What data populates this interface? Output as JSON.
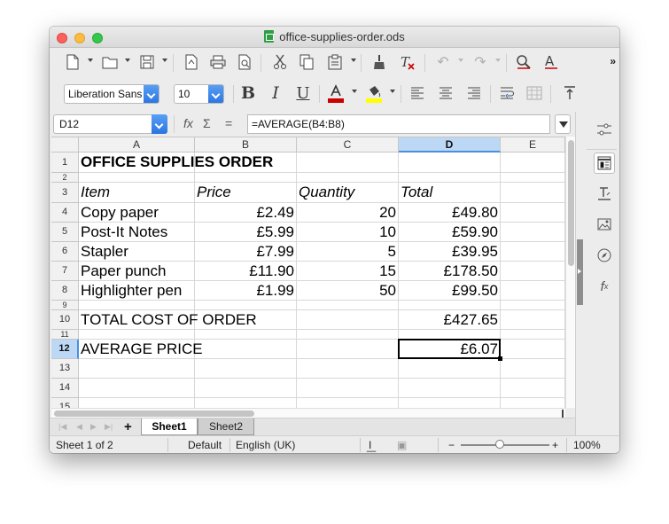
{
  "window": {
    "title": "office-supplies-order.ods"
  },
  "icons": {
    "new": "new-document-icon",
    "open": "open-folder-icon",
    "save": "save-icon",
    "export_pdf": "export-pdf-icon",
    "print": "print-icon",
    "print_preview": "print-preview-icon",
    "cut": "cut-icon",
    "copy": "copy-icon",
    "paste": "paste-icon",
    "clone": "clone-formatting-icon",
    "clear": "clear-formatting-icon",
    "undo": "undo-icon",
    "redo": "redo-icon",
    "find": "find-replace-icon",
    "spelling": "spelling-icon"
  },
  "toolbar2": {
    "font_name": "Liberation Sans",
    "font_size": "10",
    "bold": "B",
    "italic": "I",
    "underline": "U",
    "font_color": "#cc0000",
    "highlight_color": "#ffff00",
    "toolbar_more": "»"
  },
  "formula_bar": {
    "cell_ref": "D12",
    "fx_label": "fx",
    "sum_label": "Σ",
    "equals_label": "=",
    "formula": "=AVERAGE(B4:B8)"
  },
  "columns": [
    "A",
    "B",
    "C",
    "D",
    "E"
  ],
  "selected_column": "D",
  "rows": [
    "1",
    "2",
    "3",
    "4",
    "5",
    "6",
    "7",
    "8",
    "9",
    "10",
    "11",
    "12",
    "13",
    "14",
    "15"
  ],
  "selected_row": "12",
  "cells": {
    "title": "OFFICE SUPPLIES ORDER",
    "header_item": "Item",
    "header_price": "Price",
    "header_quantity": "Quantity",
    "header_total": "Total",
    "items": [
      {
        "item": "Copy paper",
        "price": "£2.49",
        "quantity": "20",
        "total": "£49.80"
      },
      {
        "item": "Post-It Notes",
        "price": "£5.99",
        "quantity": "10",
        "total": "£59.90"
      },
      {
        "item": "Stapler",
        "price": "£7.99",
        "quantity": "5",
        "total": "£39.95"
      },
      {
        "item": "Paper punch",
        "price": "£11.90",
        "quantity": "15",
        "total": "£178.50"
      },
      {
        "item": "Highlighter pen",
        "price": "£1.99",
        "quantity": "50",
        "total": "£99.50"
      }
    ],
    "total_label": "TOTAL COST OF ORDER",
    "total_value": "£427.65",
    "average_label": "AVERAGE PRICE",
    "average_value": "£6.07"
  },
  "sheet_tabs": {
    "add": "+",
    "sheets": [
      "Sheet1",
      "Sheet2"
    ],
    "active": "Sheet1"
  },
  "status_bar": {
    "sheet_info": "Sheet 1 of 2",
    "page_style": "Default",
    "language": "English (UK)",
    "zoom_minus": "−",
    "zoom_plus": "+",
    "zoom": "100%"
  },
  "sidebar": {
    "properties": "properties-icon",
    "styles": "styles-icon",
    "gallery": "gallery-icon",
    "navigator": "navigator-icon",
    "functions": "functions-icon",
    "settings": "sidebar-settings-icon"
  }
}
